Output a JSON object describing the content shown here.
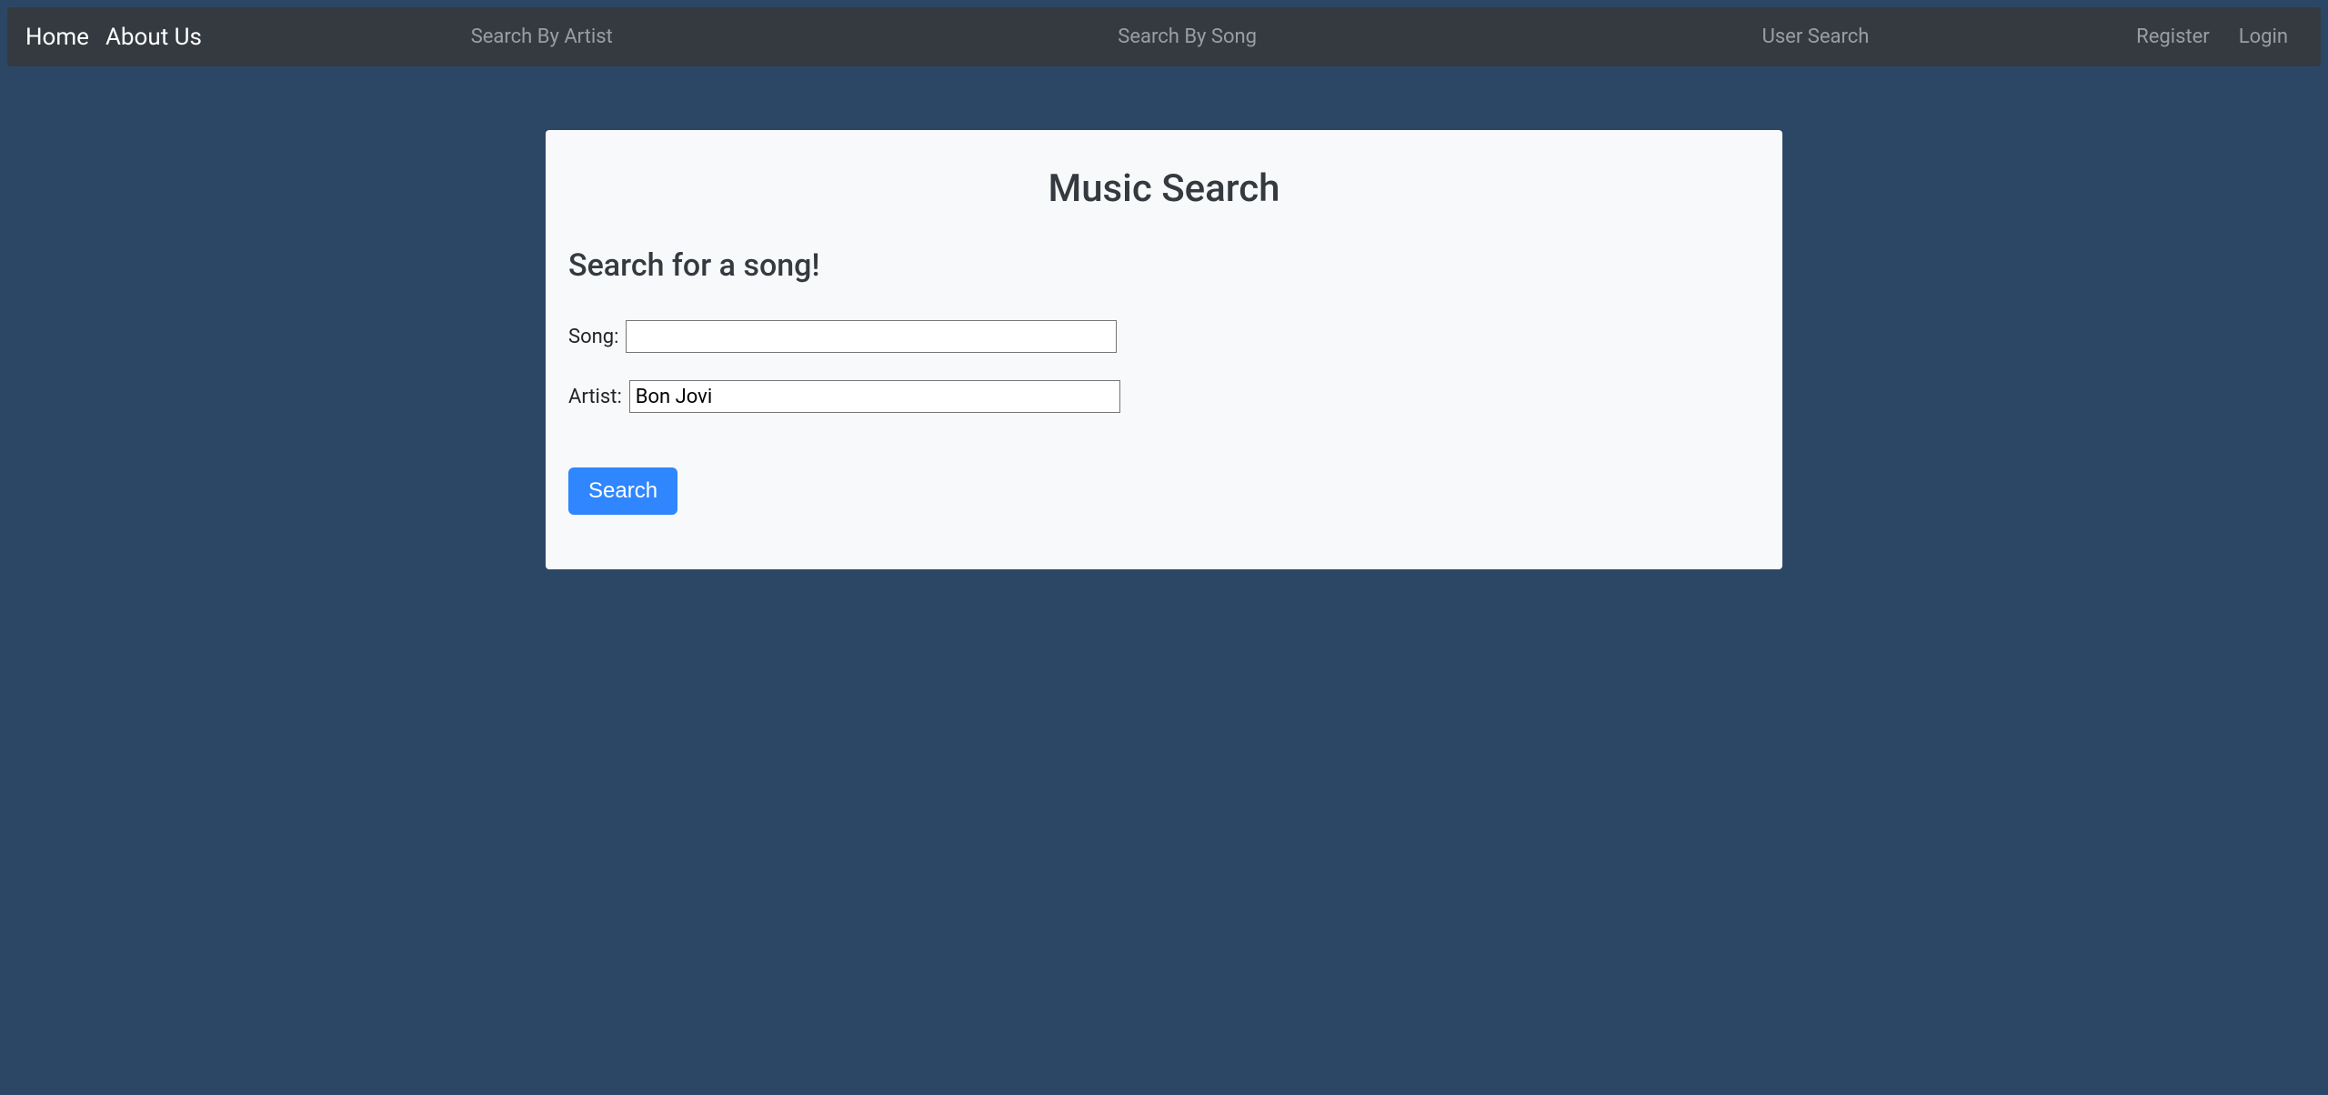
{
  "nav": {
    "home": "Home",
    "about": "About Us",
    "search_by_artist": "Search By Artist",
    "search_by_song": "Search By Song",
    "user_search": "User Search",
    "register": "Register",
    "login": "Login"
  },
  "page": {
    "title": "Music Search",
    "subtitle": "Search for a song!"
  },
  "form": {
    "song_label": "Song:",
    "song_value": "",
    "artist_label": "Artist:",
    "artist_value": "Bon Jovi",
    "search_button": "Search"
  }
}
